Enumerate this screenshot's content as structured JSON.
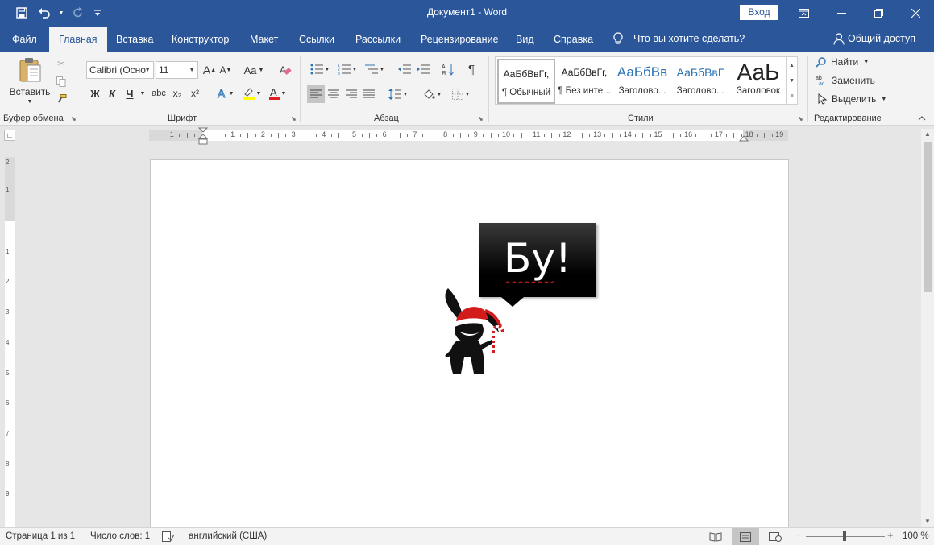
{
  "window": {
    "title": "Документ1  -  Word",
    "signin_label": "Вход"
  },
  "tabs": [
    {
      "label": "Файл"
    },
    {
      "label": "Главная"
    },
    {
      "label": "Вставка"
    },
    {
      "label": "Конструктор"
    },
    {
      "label": "Макет"
    },
    {
      "label": "Ссылки"
    },
    {
      "label": "Рассылки"
    },
    {
      "label": "Рецензирование"
    },
    {
      "label": "Вид"
    },
    {
      "label": "Справка"
    }
  ],
  "tell_me": "Что вы хотите сделать?",
  "share_label": "Общий доступ",
  "ribbon": {
    "clipboard": {
      "paste_label": "Вставить",
      "group_label": "Буфер обмена"
    },
    "font": {
      "font_name": "Calibri (Осно",
      "font_size": "11",
      "group_label": "Шрифт",
      "bold": "Ж",
      "italic": "К",
      "underline": "Ч",
      "strike": "abc",
      "subscript": "x₂",
      "superscript": "x²",
      "grow": "A",
      "shrink": "A",
      "case": "Aa"
    },
    "paragraph": {
      "group_label": "Абзац",
      "pilcrow": "¶"
    },
    "styles": {
      "group_label": "Стили",
      "items": [
        {
          "sample": "АаБбВвГг,",
          "name": "¶ Обычный"
        },
        {
          "sample": "АаБбВвГг,",
          "name": "¶ Без инте..."
        },
        {
          "sample": "АаБбВв",
          "name": "Заголово..."
        },
        {
          "sample": "АаБбВвГ",
          "name": "Заголово..."
        },
        {
          "sample": "АаЬ",
          "name": "Заголовок"
        }
      ]
    },
    "editing": {
      "group_label": "Редактирование",
      "find": "Найти",
      "replace": "Заменить",
      "select": "Выделить"
    }
  },
  "ruler": {
    "h_labels": [
      "1",
      "1",
      "2",
      "3",
      "4",
      "5",
      "6",
      "7",
      "8",
      "9",
      "10",
      "11",
      "12",
      "13",
      "14",
      "15",
      "16",
      "17",
      "18",
      "19"
    ],
    "v_labels": [
      "2",
      "1",
      "1",
      "2",
      "3",
      "4",
      "5",
      "6",
      "7",
      "8",
      "9"
    ]
  },
  "document": {
    "callout_text": "Бу!"
  },
  "status": {
    "page": "Страница 1 из 1",
    "words": "Число слов: 1",
    "language": "английский (США)",
    "zoom": "100 %",
    "zoom_percent": 100
  },
  "colors": {
    "brand": "#2b579a",
    "ribbon_bg": "#f3f3f3",
    "heading_blue": "#2e74b5"
  }
}
